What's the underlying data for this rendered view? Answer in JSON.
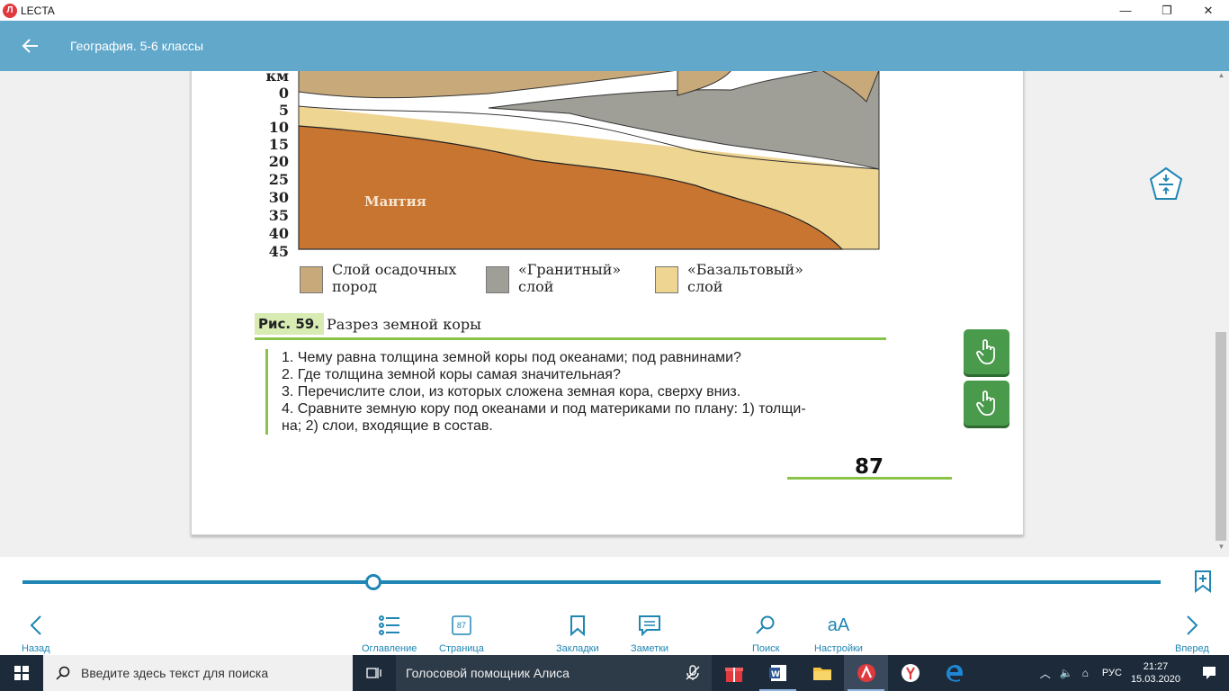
{
  "window": {
    "app_name": "LECTA",
    "logo_letter": "Л",
    "minimize": "—",
    "maximize": "❐",
    "close": "✕"
  },
  "appbar": {
    "title": "География. 5-6 классы"
  },
  "figure": {
    "scale_unit": "км",
    "scale": [
      "0",
      "5",
      "10",
      "15",
      "20",
      "25",
      "30",
      "35",
      "40",
      "45"
    ],
    "mantle_label": "Мантия",
    "legend": [
      {
        "line1": "Слой осадочных",
        "line2": "пород",
        "color": "#c8a97a"
      },
      {
        "line1": "«Гранитный»",
        "line2": "слой",
        "color": "#9f9e97"
      },
      {
        "line1": "«Базальтовый»",
        "line2": "слой",
        "color": "#efd592"
      }
    ],
    "fig_label": "Рис. 59.",
    "fig_title": "Разрез земной коры",
    "colors": {
      "ocean": "#bfe3ee",
      "mantle": "#c87532",
      "accent": "#8bc34a"
    }
  },
  "questions": [
    "1. Чему равна толщина земной коры под океанами; под равнинами?",
    "2. Где толщина земной коры самая значительная?",
    "3. Перечислите слои, из которых сложена земная кора, сверху вниз.",
    "4. Сравните земную кору под океанами и под материками по плану: 1) толщи-",
    "на; 2) слои, входящие в состав."
  ],
  "page_number": "87",
  "nav": {
    "back": "Назад",
    "toc": "Оглавление",
    "page": "Страница",
    "page_icon_num": "87",
    "bookmarks": "Закладки",
    "notes": "Заметки",
    "search": "Поиск",
    "settings": "Настройки",
    "settings_icon": "aA",
    "forward": "Вперед"
  },
  "slider": {
    "progress_fraction": 0.3
  },
  "taskbar": {
    "search_placeholder": "Введите здесь текст для поиска",
    "assistant": "Голосовой помощник Алиса",
    "lang": "РУС",
    "time": "21:27",
    "date": "15.03.2020"
  }
}
